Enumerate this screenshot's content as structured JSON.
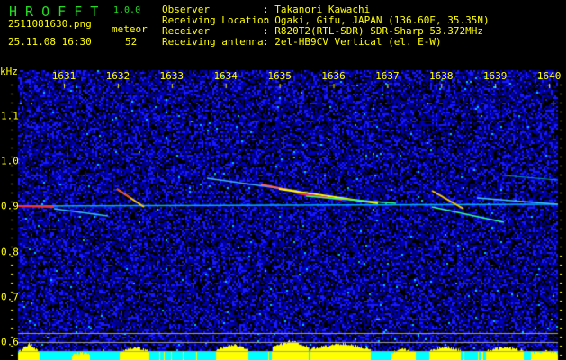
{
  "app": {
    "name_letters": "H R O F F T",
    "version": "1.0.0"
  },
  "file": {
    "name": "2511081630.png",
    "datetime": "25.11.08 16:30"
  },
  "meteor": {
    "label": "meteor",
    "count": "52"
  },
  "info": [
    {
      "key": "Observer",
      "value": ": Takanori Kawachi"
    },
    {
      "key": "Receiving Location",
      "value": ": Ogaki, Gifu, JAPAN (136.60E, 35.35N)"
    },
    {
      "key": "Receiver",
      "value": ": R820T2(RTL-SDR) SDR-Sharp 53.372MHz"
    },
    {
      "key": "Receiving antenna",
      "value": ": 2el-HB9CV Vertical (el. E-W)"
    }
  ],
  "axis": {
    "y_unit": "kHz",
    "x_ticks": [
      "1631",
      "1632",
      "1633",
      "1634",
      "1635",
      "1636",
      "1637",
      "1638",
      "1639",
      "1640"
    ],
    "y_ticks": [
      "1.1",
      "1.0",
      "0.9",
      "0.8",
      "0.7",
      "0.6"
    ]
  },
  "colors": {
    "text": "#ffff00",
    "title": "#22dd22",
    "background": "#000000",
    "noise": "#0000c8",
    "histogram": "#ffff00",
    "baseline": "#00ffff"
  }
}
